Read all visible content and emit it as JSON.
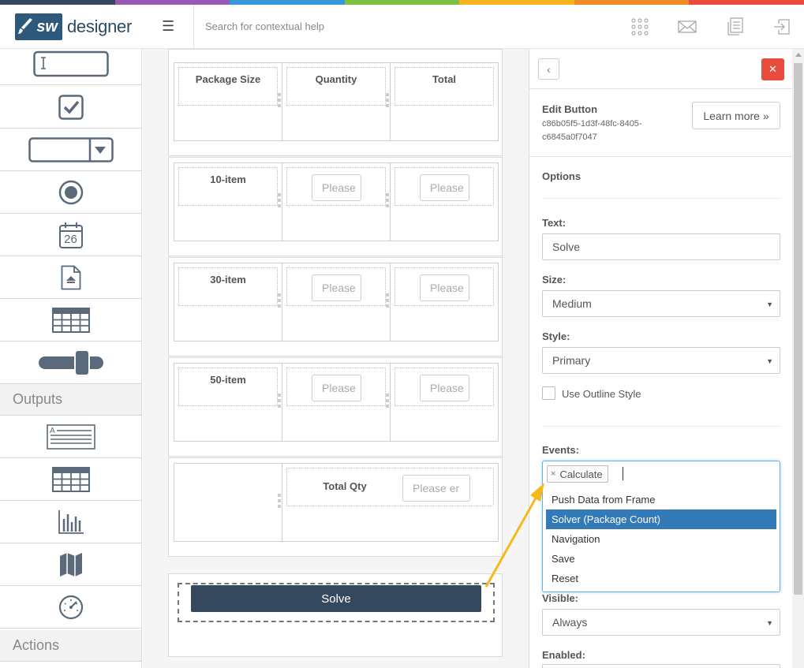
{
  "brand": {
    "logo_badge": "sw",
    "name": "designer",
    "stripe_colors": [
      "#34495e",
      "#9b59b6",
      "#3498db",
      "#7ac143",
      "#f6b31b",
      "#f08a24",
      "#e74c3c"
    ]
  },
  "header": {
    "search_placeholder": "Search for contextual help",
    "icons": [
      "apps-grid-icon",
      "mail-icon",
      "document-stack-icon",
      "sign-out-icon"
    ]
  },
  "sidebar": {
    "input_tools": [
      "text-input-icon",
      "checkbox-icon",
      "dropdown-icon",
      "radio-icon",
      "calendar-icon",
      "file-upload-icon",
      "table-icon",
      "slider-icon"
    ],
    "calendar_day": "26",
    "outputs_label": "Outputs",
    "output_tools": [
      "text-output-icon",
      "table-output-icon",
      "bar-chart-icon",
      "map-icon",
      "gauge-icon"
    ],
    "actions_label": "Actions"
  },
  "canvas": {
    "headers": [
      "Package Size",
      "Quantity",
      "Total"
    ],
    "rows": [
      {
        "label": "10-item",
        "qty_placeholder": "Please",
        "total_placeholder": "Please"
      },
      {
        "label": "30-item",
        "qty_placeholder": "Please",
        "total_placeholder": "Please"
      },
      {
        "label": "50-item",
        "qty_placeholder": "Please",
        "total_placeholder": "Please"
      }
    ],
    "total_qty_label": "Total Qty",
    "total_qty_placeholder": "Please er",
    "solve_label": "Solve"
  },
  "panel": {
    "back_symbol": "‹",
    "close_symbol": "✕",
    "title": "Edit Button",
    "element_id": "c86b05f5-1d3f-48fc-8405-c6845a0f7047",
    "learn_more": "Learn more »",
    "options_label": "Options",
    "text_label": "Text:",
    "text_value": "Solve",
    "size_label": "Size:",
    "size_value": "Medium",
    "style_label": "Style:",
    "style_value": "Primary",
    "outline_label": "Use Outline Style",
    "events_label": "Events:",
    "event_token": "Calculate",
    "event_token_remove": "×",
    "event_options": [
      "Push Data from Frame",
      "Solver (Package Count)",
      "Navigation",
      "Save",
      "Reset"
    ],
    "event_selected_index": 1,
    "visible_label": "Visible:",
    "visible_value": "Always",
    "enabled_label": "Enabled:"
  },
  "colors": {
    "accent": "#337ab7",
    "button_dark": "#34495e",
    "close_red": "#e74c3c",
    "arrow": "#f6b91b"
  }
}
